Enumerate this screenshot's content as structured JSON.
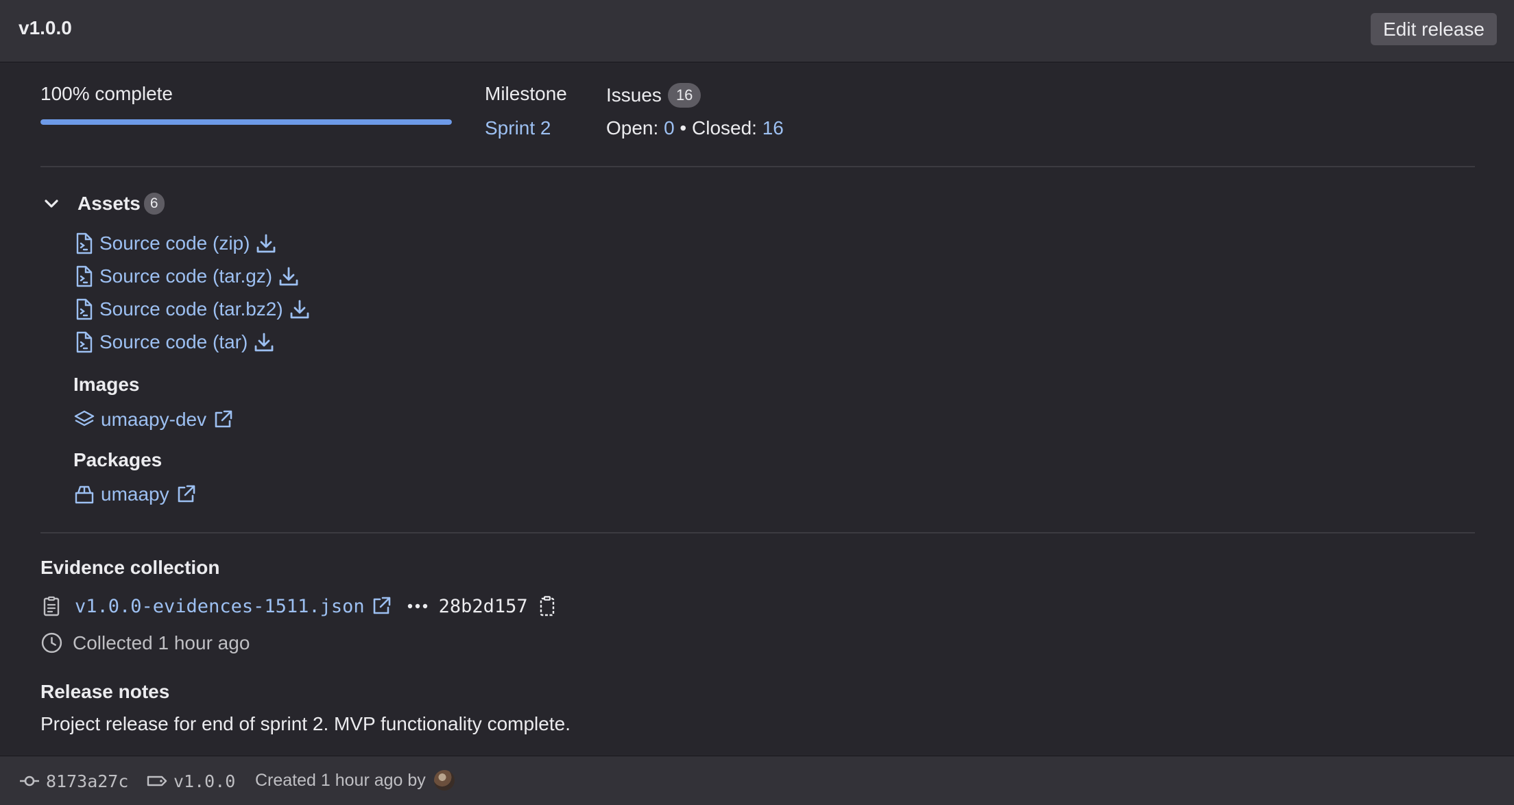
{
  "header": {
    "tag_name": "v1.0.0",
    "edit_label": "Edit release"
  },
  "progress": {
    "label": "100% complete",
    "fraction": 1.0
  },
  "milestone": {
    "label": "Milestone",
    "link": "Sprint 2"
  },
  "issues": {
    "label": "Issues",
    "count": "16",
    "open_label": "Open:",
    "open_value": "0",
    "separator": "•",
    "closed_label": "Closed:",
    "closed_value": "16"
  },
  "assets": {
    "title": "Assets",
    "count": "6",
    "sources": [
      {
        "label": "Source code (zip)"
      },
      {
        "label": "Source code (tar.gz)"
      },
      {
        "label": "Source code (tar.bz2)"
      },
      {
        "label": "Source code (tar)"
      }
    ],
    "images_title": "Images",
    "image_link": "umaapy-dev",
    "packages_title": "Packages",
    "package_link": "umaapy"
  },
  "evidence": {
    "title": "Evidence collection",
    "file": "v1.0.0-evidences-1511.json",
    "sha": "28b2d157",
    "collected": "Collected 1 hour ago"
  },
  "notes": {
    "title": "Release notes",
    "text": "Project release for end of sprint 2. MVP functionality complete."
  },
  "footer": {
    "commit": "8173a27c",
    "tag": "v1.0.0",
    "created": "Created 1 hour ago by"
  },
  "colors": {
    "background": "#27262c",
    "header": "#333238",
    "link": "#9dc0f2",
    "progress": "#6d9ae8",
    "badge": "#5e5c63"
  },
  "icons": [
    "chevron-down-icon",
    "file-code-icon",
    "download-icon",
    "container-image-icon",
    "external-link-icon",
    "package-icon",
    "clipboard-icon",
    "ellipsis-icon",
    "copy-icon",
    "clock-icon",
    "commit-icon",
    "tag-icon"
  ]
}
